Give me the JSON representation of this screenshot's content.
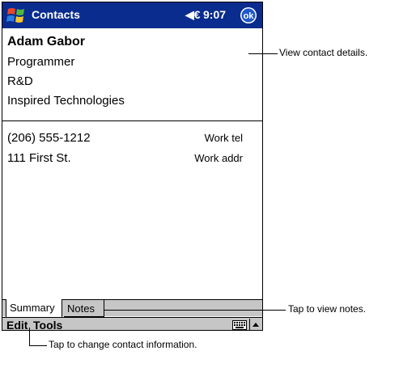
{
  "titlebar": {
    "app_title": "Contacts",
    "volume_icon": "speaker-icon",
    "volume_glyph": "◀€",
    "time": "9:07",
    "ok_label": "ok",
    "colors": {
      "bar": "#0a2c8e",
      "ok": "#1f58c9"
    }
  },
  "contact": {
    "name": "Adam Gabor",
    "job_title": "Programmer",
    "department": "R&D",
    "company": "Inspired Technologies"
  },
  "fields": [
    {
      "value": "(206) 555-1212",
      "label": "Work tel"
    },
    {
      "value": "111 First St.",
      "label": "Work addr"
    }
  ],
  "tabs": [
    {
      "label": "Summary",
      "active": true
    },
    {
      "label": "Notes",
      "active": false
    }
  ],
  "menubar": {
    "edit_label": "Edit",
    "tools_label": "Tools",
    "keyboard_icon": "keyboard-icon",
    "up_arrow_icon": "up-arrow-icon"
  },
  "callouts": {
    "view_details": "View contact details.",
    "view_notes": "Tap to view notes.",
    "change_info": "Tap to change contact information."
  }
}
